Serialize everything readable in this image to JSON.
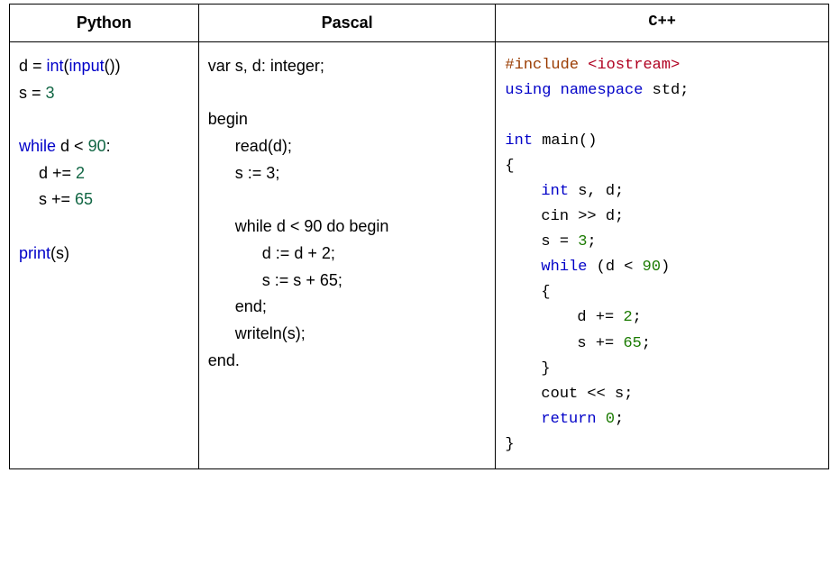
{
  "headers": {
    "python": "Python",
    "pascal": "Pascal",
    "cpp": "C++"
  },
  "python": {
    "l1a": "d = ",
    "l1b": "int",
    "l1c": "(",
    "l1d": "input",
    "l1e": "())",
    "l2a": "s = ",
    "l2b": "3",
    "l3a": "while",
    "l3b": " d < ",
    "l3c": "90",
    "l3d": ":",
    "l4a": "d += ",
    "l4b": "2",
    "l5a": "s += ",
    "l5b": "65",
    "l6a": "print",
    "l6b": "(s)"
  },
  "pascal": {
    "l1": "var s, d: integer;",
    "l2": "begin",
    "l3": "read(d);",
    "l4": "s := 3;",
    "l5": "while d < 90 do begin",
    "l6": "d := d + 2;",
    "l7": "s := s + 65;",
    "l8": "end;",
    "l9": "writeln(s);",
    "l10": "end."
  },
  "cpp": {
    "l1a": "#include ",
    "l1b": "<iostream>",
    "l2a": "using ",
    "l2b": "namespace",
    "l2c": " std;",
    "l3a": "int",
    "l3b": " main()",
    "l4": "{",
    "l5a": "int",
    "l5b": " s, d;",
    "l6": "cin >> d;",
    "l7a": "s = ",
    "l7b": "3",
    "l7c": ";",
    "l8a": "while",
    "l8b": " (d < ",
    "l8c": "90",
    "l8d": ")",
    "l9": "{",
    "l10a": "d += ",
    "l10b": "2",
    "l10c": ";",
    "l11a": "s += ",
    "l11b": "65",
    "l11c": ";",
    "l12": "}",
    "l13": "cout << s;",
    "l14a": "return",
    "l14b": " ",
    "l14c": "0",
    "l14d": ";",
    "l15": "}"
  }
}
